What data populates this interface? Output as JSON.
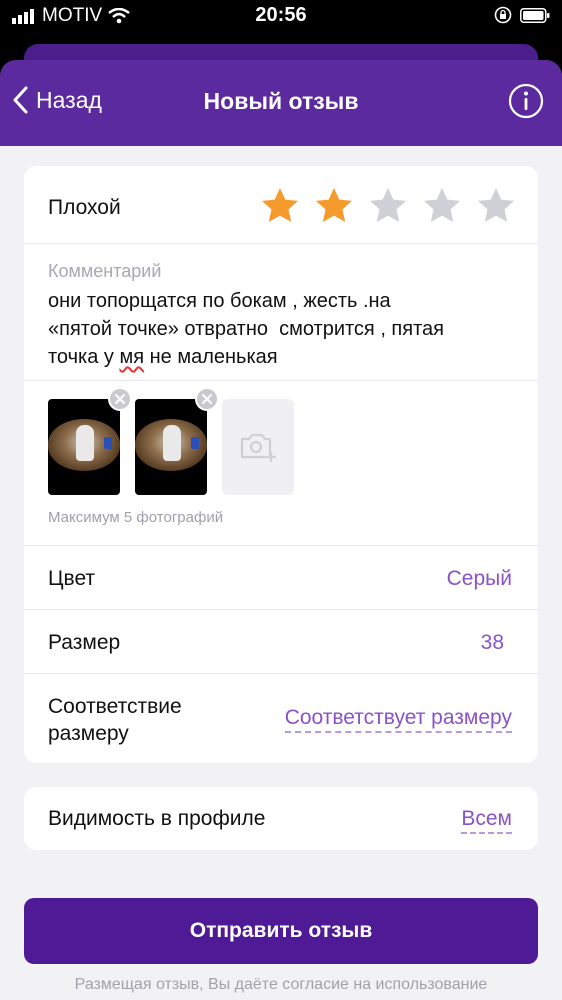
{
  "status_bar": {
    "carrier": "MOTIV",
    "time": "20:56"
  },
  "header": {
    "back_label": "Назад",
    "title": "Новый отзыв"
  },
  "rating": {
    "label": "Плохой",
    "value": 2,
    "max": 5,
    "active_color": "#f59a2c",
    "inactive_color": "#cfcfd6"
  },
  "comment": {
    "label": "Комментарий",
    "text_before": "они топорщатся по бокам , жесть .на\n«пятой точке» отвратно  смотрится , пятая\nточка у ",
    "misspelled": "мя",
    "text_after": " не маленькая"
  },
  "photos": {
    "count": 2,
    "hint": "Максимум 5 фотографий"
  },
  "attributes": {
    "color_label": "Цвет",
    "color_value": "Серый",
    "size_label": "Размер",
    "size_value": "38",
    "fit_label": "Соответствие\nразмеру",
    "fit_value": "Соответствует размеру"
  },
  "visibility": {
    "label": "Видимость в профиле",
    "value": "Всем"
  },
  "submit_label": "Отправить отзыв",
  "consent_text": "Размещая отзыв, Вы даёте согласие на использование",
  "colors": {
    "header": "#5b2a9e",
    "accent": "#8a52c8",
    "button": "#4f1a95"
  }
}
